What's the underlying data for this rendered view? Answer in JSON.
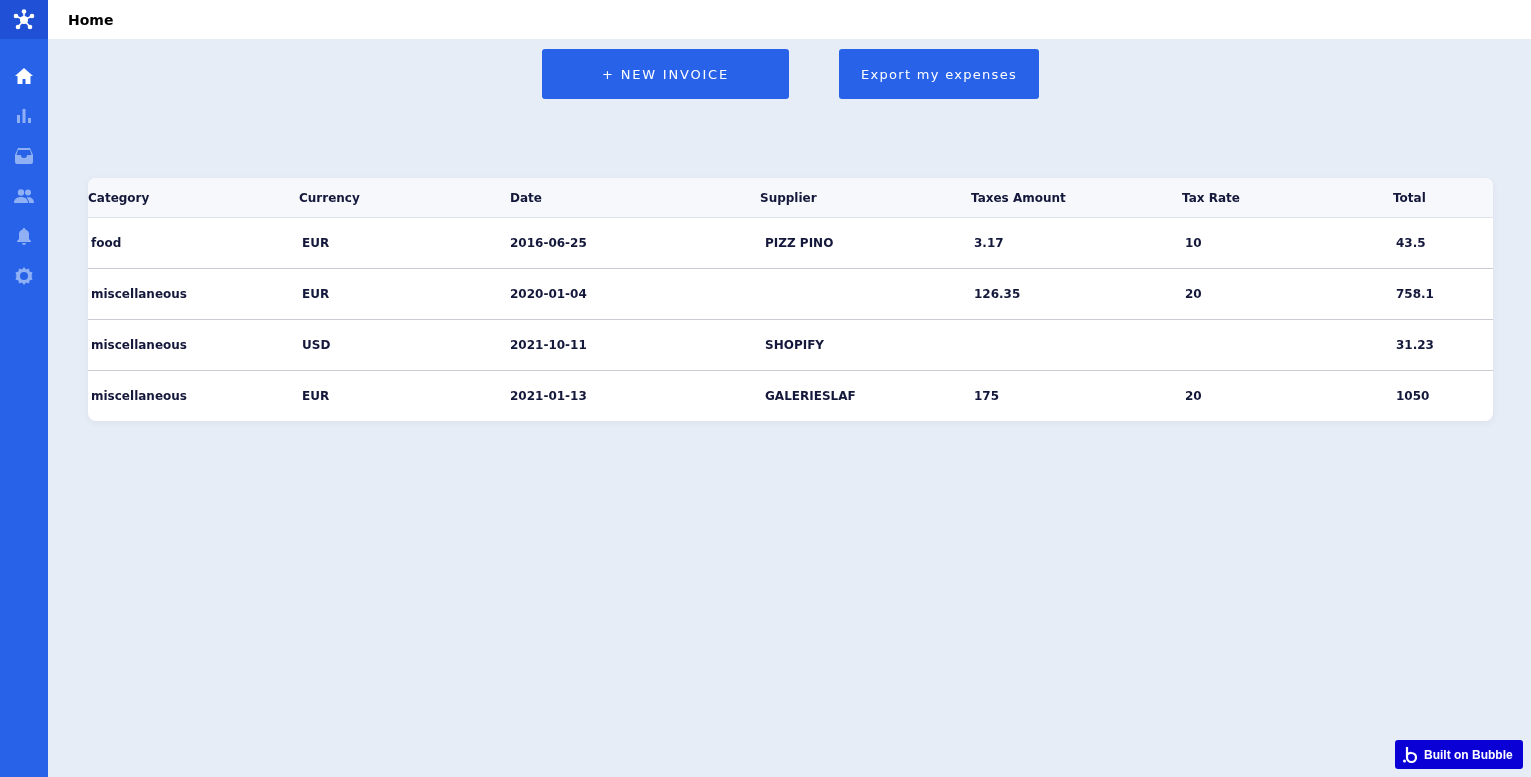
{
  "header": {
    "title": "Home"
  },
  "sidebar": {
    "items": [
      {
        "kind": "home",
        "selected": true
      },
      {
        "kind": "chart",
        "selected": false
      },
      {
        "kind": "inbox",
        "selected": false
      },
      {
        "kind": "people",
        "selected": false
      },
      {
        "kind": "bell",
        "selected": false
      },
      {
        "kind": "settings",
        "selected": false
      }
    ]
  },
  "actions": [
    "+ NEW INVOICE",
    "Export my expenses"
  ],
  "table": {
    "columns": [
      "Category",
      "Currency",
      "Date",
      "Supplier",
      "Taxes Amount",
      "Tax Rate",
      "Total"
    ],
    "rows": [
      [
        "food",
        "EUR",
        "2016-06-25",
        "PIZZ PINO",
        "3.17",
        "10",
        "43.5"
      ],
      [
        "miscellaneous",
        "EUR",
        "2020-01-04",
        "",
        "126.35",
        "20",
        "758.1"
      ],
      [
        "miscellaneous",
        "USD",
        "2021-10-11",
        "SHOPIFY",
        "",
        "",
        "31.23"
      ],
      [
        "miscellaneous",
        "EUR",
        "2021-01-13",
        "GALERIESLAF",
        "175",
        "20",
        "1050"
      ]
    ]
  },
  "badge": {
    "label": "Built on Bubble"
  }
}
